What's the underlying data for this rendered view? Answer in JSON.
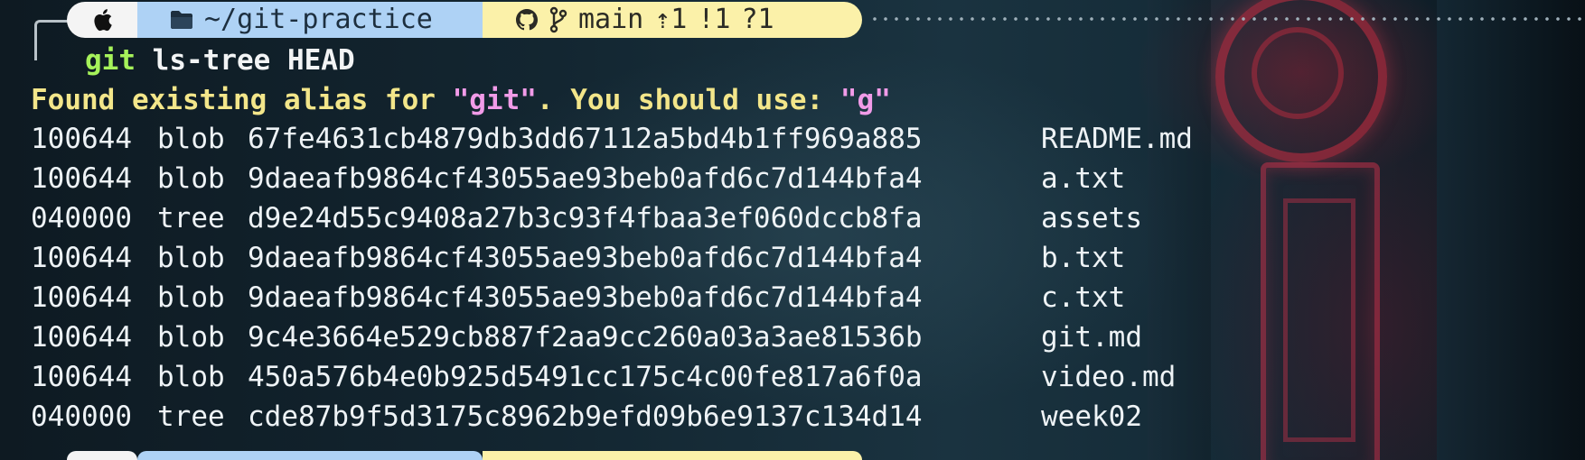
{
  "prompt": {
    "os_icon": "apple-icon",
    "dir_icon": "folder-icon",
    "directory": "~/git-practice",
    "git_icon": "github-icon",
    "branch_icon": "git-branch-icon",
    "branch": "main",
    "ahead": "⇡1",
    "modified": "!1",
    "untracked": "?1",
    "colors": {
      "os_segment": "#f4f4f4",
      "dir_segment": "#aed2f5",
      "git_segment": "#fbf1a9"
    }
  },
  "command": {
    "program": "git",
    "args": " ls-tree HEAD"
  },
  "alias_warning": {
    "prefix": "Found existing alias for ",
    "alias_target": "\"git\"",
    "middle": ". You should use: ",
    "alias": "\"g\""
  },
  "tree_entries": [
    {
      "mode": "100644",
      "type": "blob",
      "hash": "67fe4631cb4879db3dd67112a5bd4b1ff969a885",
      "name": "README.md"
    },
    {
      "mode": "100644",
      "type": "blob",
      "hash": "9daeafb9864cf43055ae93beb0afd6c7d144bfa4",
      "name": "a.txt"
    },
    {
      "mode": "040000",
      "type": "tree",
      "hash": "d9e24d55c9408a27b3c93f4fbaa3ef060dccb8fa",
      "name": "assets"
    },
    {
      "mode": "100644",
      "type": "blob",
      "hash": "9daeafb9864cf43055ae93beb0afd6c7d144bfa4",
      "name": "b.txt"
    },
    {
      "mode": "100644",
      "type": "blob",
      "hash": "9daeafb9864cf43055ae93beb0afd6c7d144bfa4",
      "name": "c.txt"
    },
    {
      "mode": "100644",
      "type": "blob",
      "hash": "9c4e3664e529cb887f2aa9cc260a03a3ae81536b",
      "name": "git.md"
    },
    {
      "mode": "100644",
      "type": "blob",
      "hash": "450a576b4e0b925d5491cc175c4c00fe817a6f0a",
      "name": "video.md"
    },
    {
      "mode": "040000",
      "type": "tree",
      "hash": "cde87b9f5d3175c8962b9efd09b6e9137c134d14",
      "name": "week02"
    }
  ]
}
